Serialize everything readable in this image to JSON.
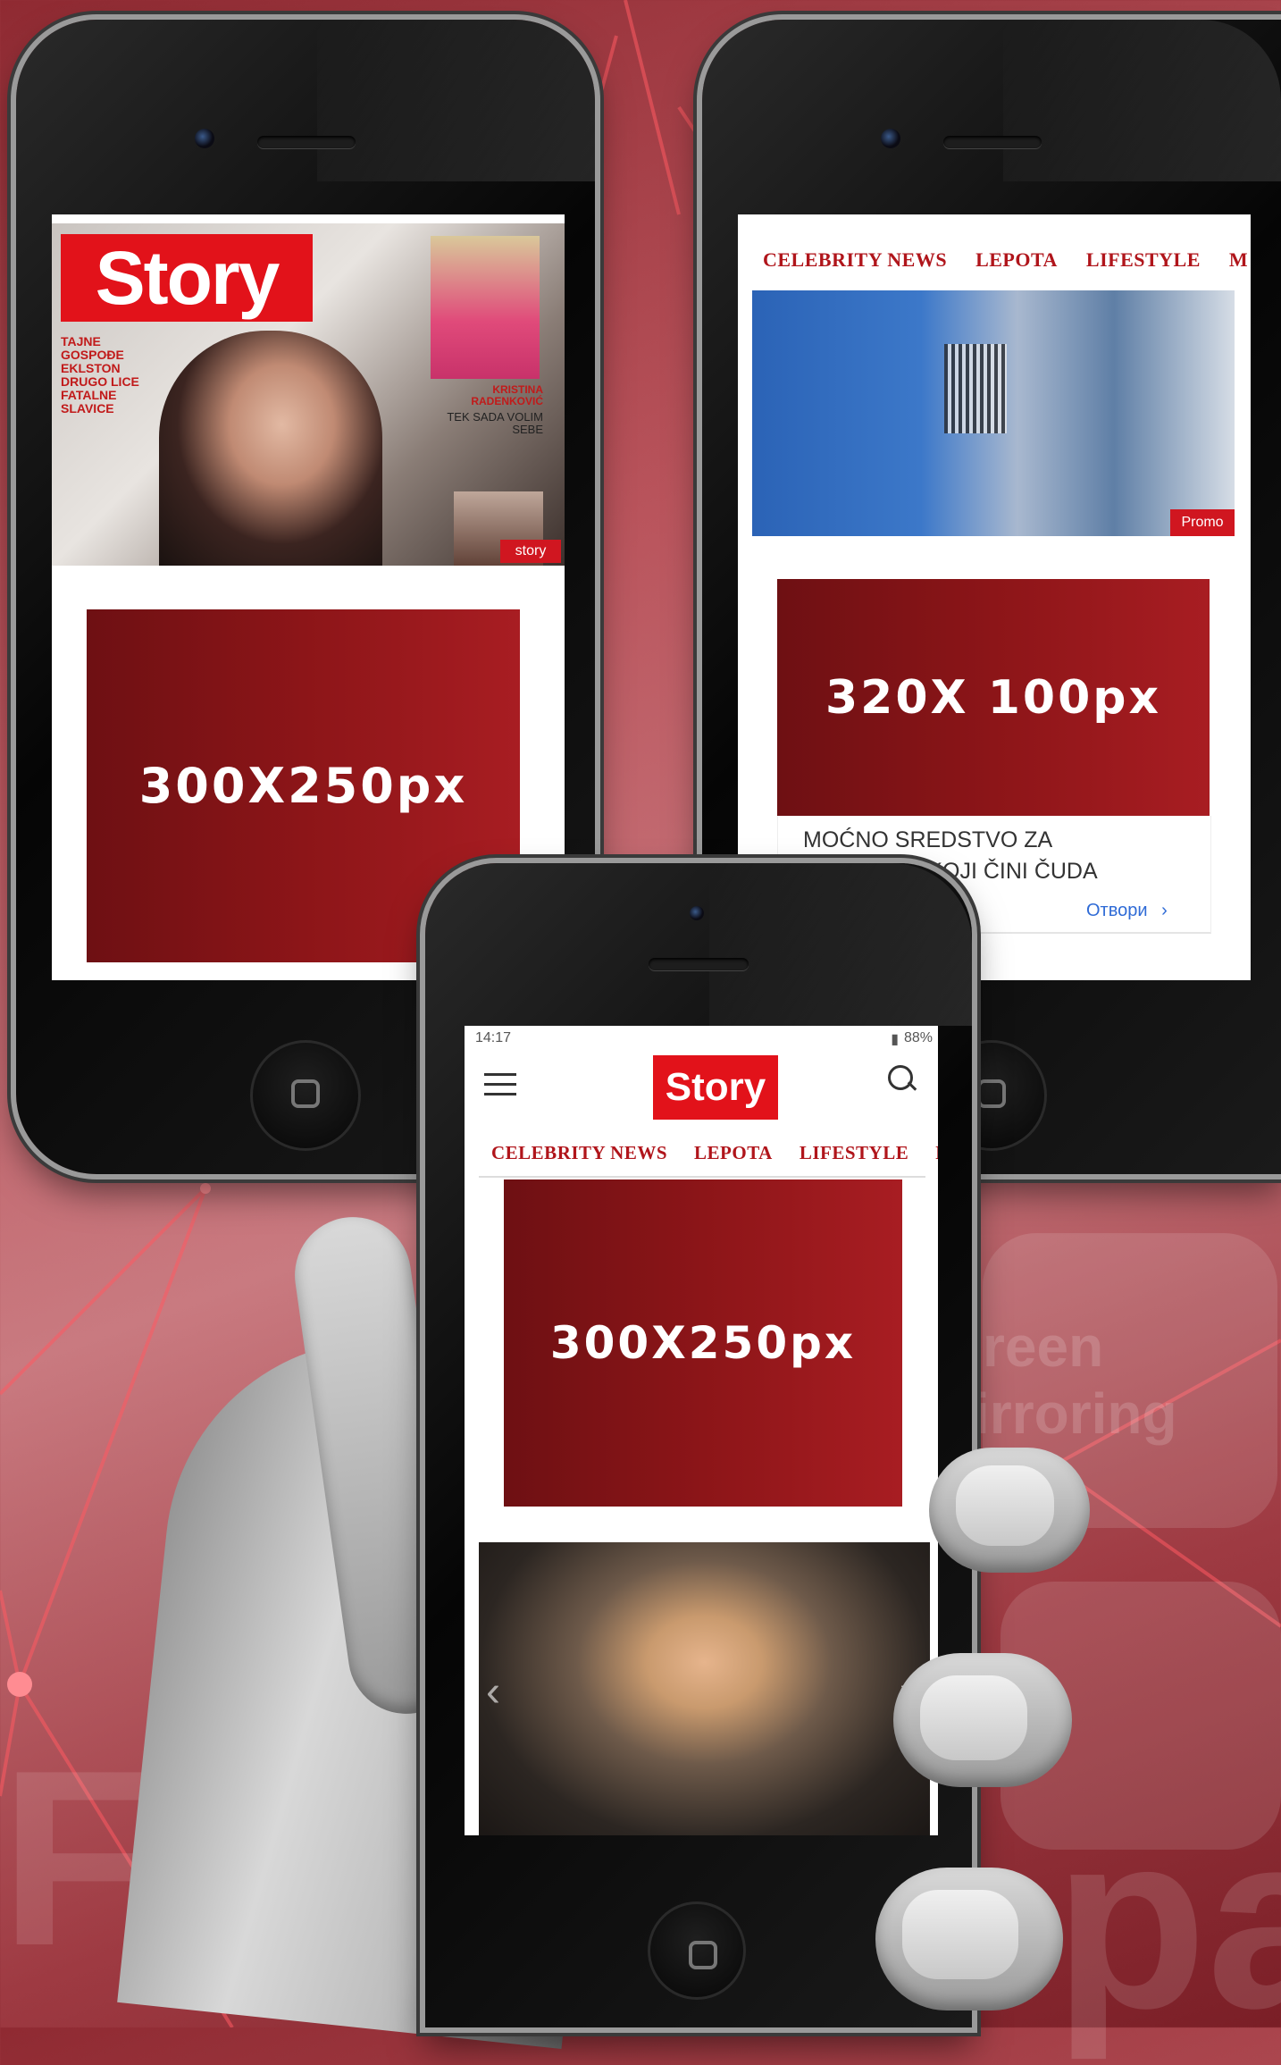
{
  "ads": {
    "left": "300X250px",
    "right": "320X 100px",
    "center": "300X250px"
  },
  "magazine": {
    "logo": "Story",
    "coverline_left": "TAJNE GOSPOĐE EKLSTON DRUGO LICE FATALNE SLAVICE",
    "coverline_right_name": "KRISTINA RADENKOVIĆ",
    "coverline_right_text": "TEK SADA VOLIM SEBE",
    "badge": "story"
  },
  "right_phone": {
    "nav": [
      "CELEBRITY NEWS",
      "LEPOTA",
      "LIFESTYLE",
      "M"
    ],
    "promo_badge": "Promo",
    "article_title": "MOĆNO SREDSTVO ZA PROSTATU KOJI ČINI ČUDA",
    "open_link": "Отвори"
  },
  "center_phone": {
    "status_time": "14:17",
    "status_right": "88%",
    "logo": "Story",
    "nav": [
      "CELEBRITY NEWS",
      "LEPOTA",
      "LIFESTYLE",
      "M"
    ]
  },
  "background_text": {
    "line1": "reen",
    "line2": "irroring"
  },
  "colors": {
    "brand_red": "#e2121a",
    "ad_red": "#8c1518",
    "nav_red": "#b0151b"
  }
}
